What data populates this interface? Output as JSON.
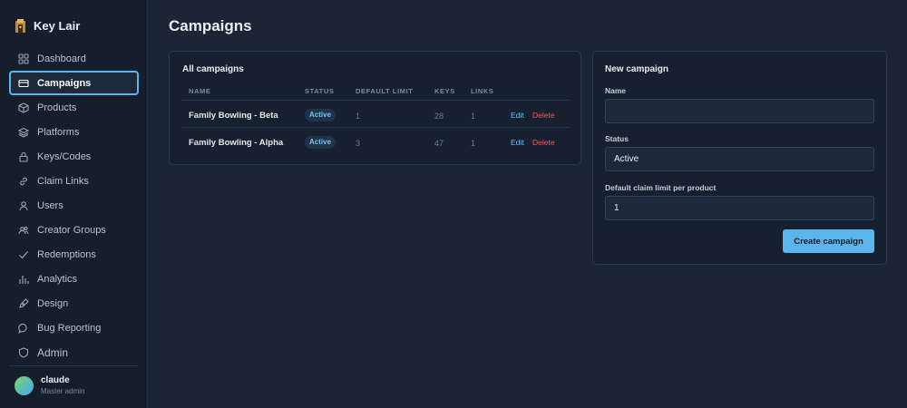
{
  "app": {
    "name": "Key Lair"
  },
  "sidebar": {
    "items": [
      {
        "label": "Dashboard",
        "icon": "dashboard-icon"
      },
      {
        "label": "Campaigns",
        "icon": "card-icon",
        "active": true
      },
      {
        "label": "Products",
        "icon": "box-icon"
      },
      {
        "label": "Platforms",
        "icon": "layers-icon"
      },
      {
        "label": "Keys/Codes",
        "icon": "lock-icon"
      },
      {
        "label": "Claim Links",
        "icon": "link-icon"
      },
      {
        "label": "Users",
        "icon": "user-icon"
      },
      {
        "label": "Creator Groups",
        "icon": "users-icon"
      },
      {
        "label": "Redemptions",
        "icon": "check-icon"
      },
      {
        "label": "Analytics",
        "icon": "bar-chart-icon"
      },
      {
        "label": "Design",
        "icon": "pen-icon"
      },
      {
        "label": "Bug Reporting",
        "icon": "message-icon"
      },
      {
        "label": "Admin",
        "icon": "shield-icon"
      }
    ],
    "user": {
      "name": "claude",
      "role": "Master admin"
    }
  },
  "page": {
    "title": "Campaigns"
  },
  "campaigns": {
    "title": "All campaigns",
    "columns": [
      "NAME",
      "STATUS",
      "DEFAULT LIMIT",
      "KEYS",
      "LINKS"
    ],
    "rows": [
      {
        "name": "Family Bowling - Beta",
        "status": "Active",
        "default_limit": "1",
        "keys": "28",
        "links": "1",
        "edit": "Edit",
        "delete": "Delete"
      },
      {
        "name": "Family Bowling - Alpha",
        "status": "Active",
        "default_limit": "3",
        "keys": "47",
        "links": "1",
        "edit": "Edit",
        "delete": "Delete"
      }
    ]
  },
  "new_campaign": {
    "title": "New campaign",
    "name_label": "Name",
    "name_value": "",
    "status_label": "Status",
    "status_value": "Active",
    "limit_label": "Default claim limit per product",
    "limit_value": "1",
    "submit_label": "Create campaign"
  },
  "colors": {
    "accent": "#5ab6ea",
    "danger": "#ef5b5b",
    "background": "#1b2536",
    "sidebar": "#161e2b"
  }
}
